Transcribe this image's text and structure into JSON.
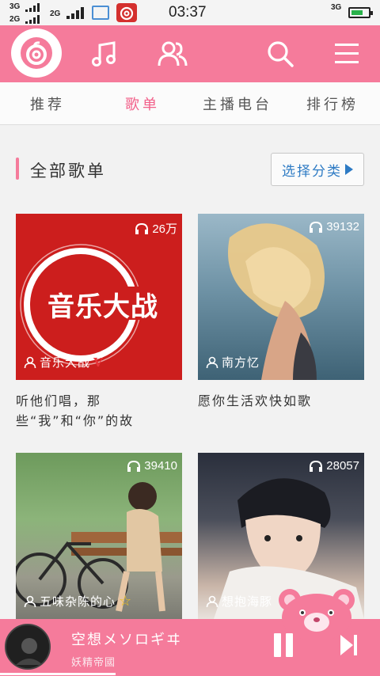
{
  "status_bar": {
    "sim1_label": "3G",
    "sim2_label": "2G",
    "sim2b_label": "2G",
    "time": "03:37",
    "net_label": "3G"
  },
  "header": {
    "icons": [
      "music-note-icon",
      "friends-icon",
      "search-icon",
      "menu-icon"
    ],
    "accent": "#f57b9b"
  },
  "tabs": [
    {
      "label": "推荐",
      "active": false
    },
    {
      "label": "歌单",
      "active": true
    },
    {
      "label": "主播电台",
      "active": false
    },
    {
      "label": "排行榜",
      "active": false
    }
  ],
  "section": {
    "title": "全部歌单",
    "choose_label": "选择分类"
  },
  "playlists": [
    {
      "play_count": "26万",
      "creator": "音乐大战",
      "badge": "V",
      "title": "听他们唱，那些“我”和“你”的故",
      "cover_text": "音乐大战"
    },
    {
      "play_count": "39132",
      "creator": "南方忆",
      "badge": "",
      "title": "愿你生活欢快如歌"
    },
    {
      "play_count": "39410",
      "creator": "五味杂陈的心",
      "badge": "☆",
      "title": ""
    },
    {
      "play_count": "28057",
      "creator": "想抱海豚",
      "badge": "",
      "title": ""
    }
  ],
  "player": {
    "song": "空想メソロギヰ",
    "artist": "妖精帝國",
    "progress": 0.3
  }
}
